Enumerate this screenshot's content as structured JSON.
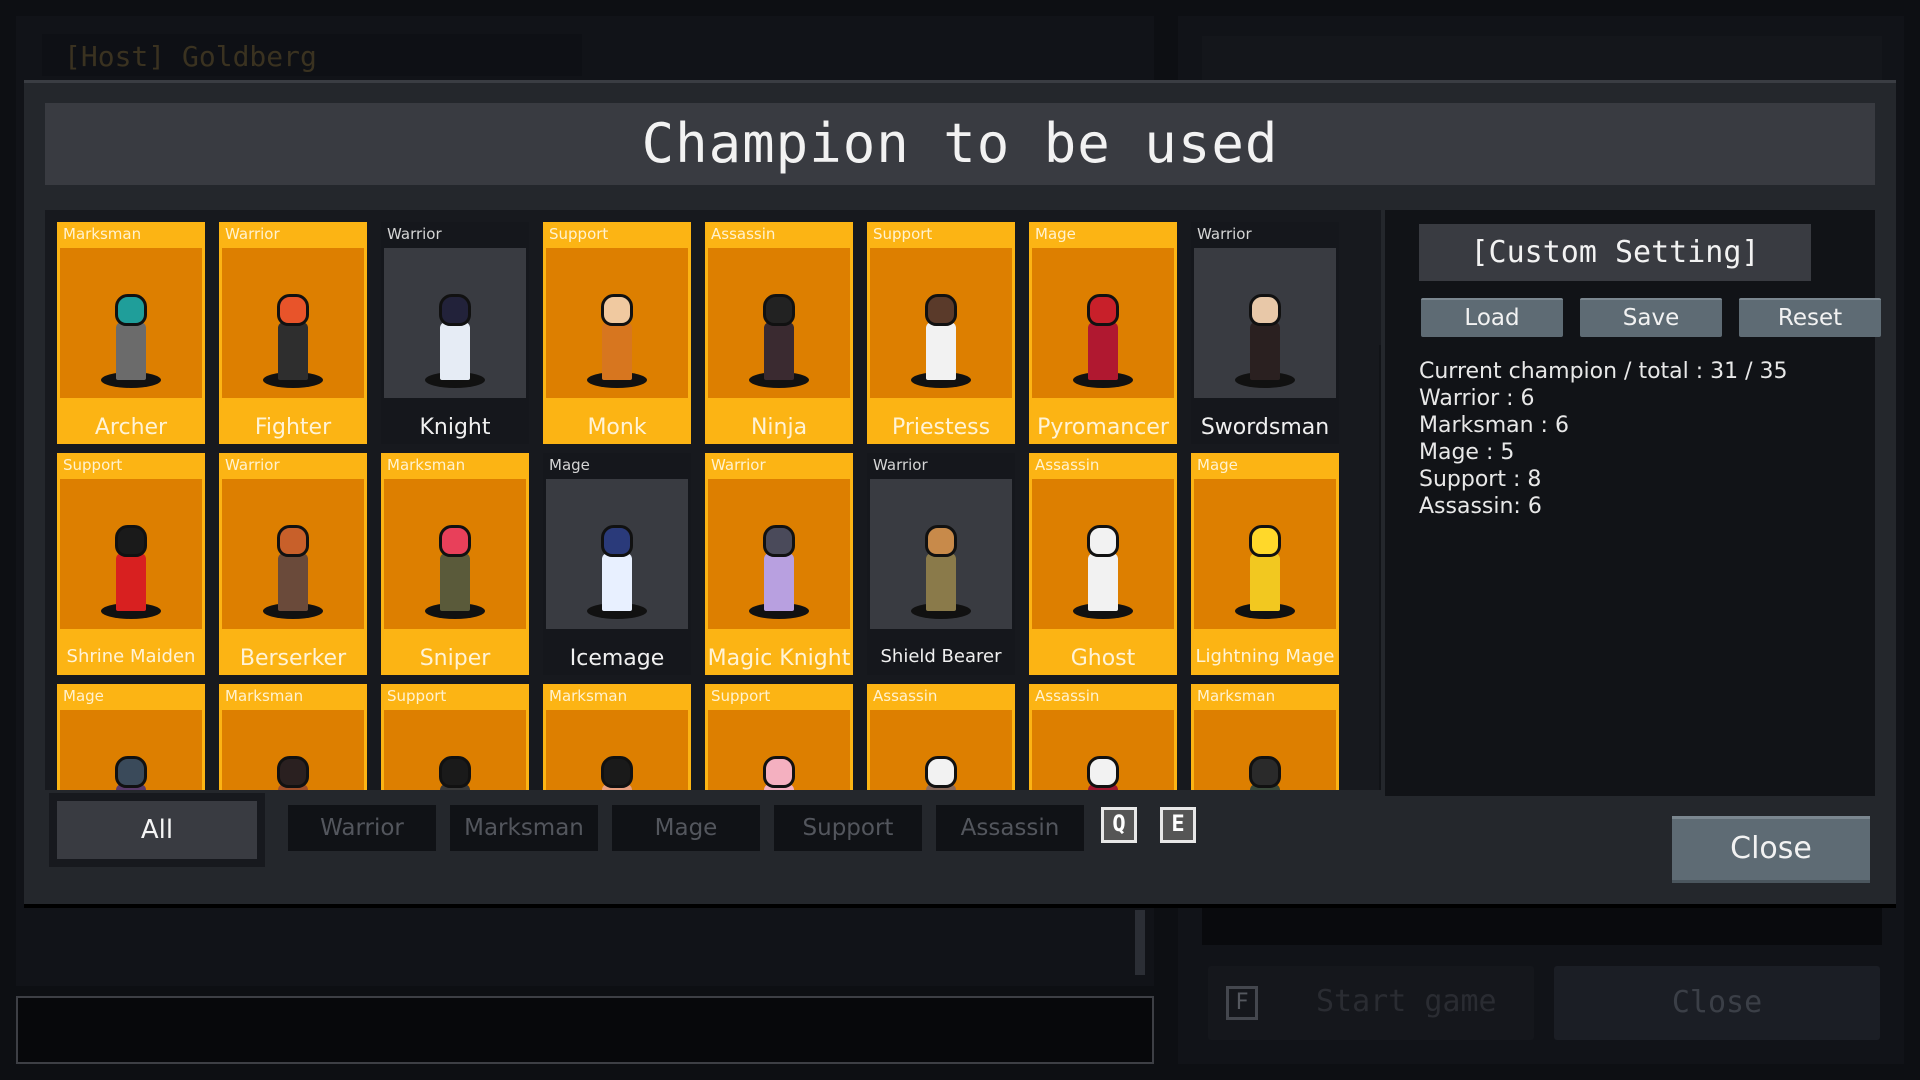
{
  "background": {
    "host_label": "[Host] Goldberg",
    "start_hotkey": "F",
    "start_label": "Start game",
    "close_label": "Close"
  },
  "dialog": {
    "title": "Champion to be used",
    "close_label": "Close"
  },
  "custom_setting": {
    "title": "[Custom Setting]",
    "load_label": "Load",
    "save_label": "Save",
    "reset_label": "Reset"
  },
  "stats": {
    "lines": [
      "Current champion / total : 31 / 35",
      "Warrior : 6",
      "Marksman : 6",
      "Mage : 5",
      "Support : 8",
      "Assassin: 6"
    ],
    "current": 31,
    "total": 35,
    "warrior": 6,
    "marksman": 6,
    "mage": 5,
    "support": 8,
    "assassin": 6
  },
  "tabs": [
    {
      "label": "All",
      "active": true
    },
    {
      "label": "Warrior",
      "active": false
    },
    {
      "label": "Marksman",
      "active": false
    },
    {
      "label": "Mage",
      "active": false
    },
    {
      "label": "Support",
      "active": false
    },
    {
      "label": "Assassin",
      "active": false
    }
  ],
  "hotkeys": {
    "prev": "Q",
    "next": "E"
  },
  "colors": {
    "selected_card": "#fcb414",
    "selected_portrait": "#dd7f00",
    "unselected_card": "#15171c",
    "unselected_portrait": "#393b41",
    "button": "#5e6b74"
  },
  "champions": [
    {
      "name": "Archer",
      "role": "Marksman",
      "selected": true,
      "hair": "#1f9e9a",
      "outfit": "#6b6b6b"
    },
    {
      "name": "Fighter",
      "role": "Warrior",
      "selected": true,
      "hair": "#e8542a",
      "outfit": "#2e2e2e"
    },
    {
      "name": "Knight",
      "role": "Warrior",
      "selected": false,
      "hair": "#22223a",
      "outfit": "#e6ecf5"
    },
    {
      "name": "Monk",
      "role": "Support",
      "selected": true,
      "hair": "#f0c9a0",
      "outfit": "#d7761f"
    },
    {
      "name": "Ninja",
      "role": "Assassin",
      "selected": true,
      "hair": "#222222",
      "outfit": "#3a2a30"
    },
    {
      "name": "Priestess",
      "role": "Support",
      "selected": true,
      "hair": "#5a3a2a",
      "outfit": "#f2f2f2"
    },
    {
      "name": "Pyromancer",
      "role": "Mage",
      "selected": true,
      "hair": "#c8202a",
      "outfit": "#b01830"
    },
    {
      "name": "Swordsman",
      "role": "Warrior",
      "selected": false,
      "hair": "#e8c8a8",
      "outfit": "#2a2020"
    },
    {
      "name": "Shrine Maiden",
      "role": "Support",
      "selected": true,
      "hair": "#1a1a1a",
      "outfit": "#d82020"
    },
    {
      "name": "Berserker",
      "role": "Warrior",
      "selected": true,
      "hair": "#c8602a",
      "outfit": "#6a4a3a"
    },
    {
      "name": "Sniper",
      "role": "Marksman",
      "selected": true,
      "hair": "#e8405a",
      "outfit": "#5a5a3a"
    },
    {
      "name": "Icemage",
      "role": "Mage",
      "selected": false,
      "hair": "#2a3a7a",
      "outfit": "#e8f0ff"
    },
    {
      "name": "Magic Knight",
      "role": "Warrior",
      "selected": true,
      "hair": "#4a4a5a",
      "outfit": "#b8a0e0"
    },
    {
      "name": "Shield Bearer",
      "role": "Warrior",
      "selected": false,
      "hair": "#c88a4a",
      "outfit": "#8a7a4a"
    },
    {
      "name": "Ghost",
      "role": "Assassin",
      "selected": true,
      "hair": "#f2f2f2",
      "outfit": "#f2f2f2"
    },
    {
      "name": "Lightning Mage",
      "role": "Mage",
      "selected": true,
      "hair": "#ffd82a",
      "outfit": "#f2c820"
    },
    {
      "name": "",
      "role": "Mage",
      "selected": true,
      "hair": "#3a4a5a",
      "outfit": "#5a3a6a"
    },
    {
      "name": "",
      "role": "Marksman",
      "selected": true,
      "hair": "#2a2020",
      "outfit": "#a0502a"
    },
    {
      "name": "",
      "role": "Support",
      "selected": true,
      "hair": "#1a1a1a",
      "outfit": "#3a3a3a"
    },
    {
      "name": "",
      "role": "Marksman",
      "selected": true,
      "hair": "#1a1a1a",
      "outfit": "#e8a080"
    },
    {
      "name": "",
      "role": "Support",
      "selected": true,
      "hair": "#f4b0c0",
      "outfit": "#f4b0c0"
    },
    {
      "name": "",
      "role": "Assassin",
      "selected": true,
      "hair": "#f2f2f2",
      "outfit": "#8a6a5a"
    },
    {
      "name": "",
      "role": "Assassin",
      "selected": true,
      "hair": "#f2f2f2",
      "outfit": "#a01830"
    },
    {
      "name": "",
      "role": "Marksman",
      "selected": true,
      "hair": "#2a2a2a",
      "outfit": "#3a4a3a"
    }
  ]
}
